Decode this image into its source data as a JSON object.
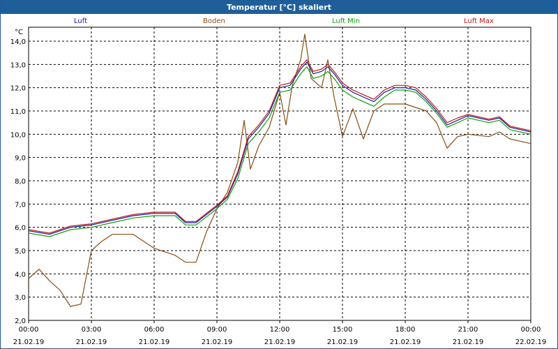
{
  "chart_data": {
    "type": "line",
    "title": "Temperatur [°C] skaliert",
    "ylabel": "°C",
    "ylim": [
      2.0,
      14.6
    ],
    "yticks": [
      "2,0",
      "3,0",
      "4,0",
      "5,0",
      "6,0",
      "7,0",
      "8,0",
      "9,0",
      "10,0",
      "11,0",
      "12,0",
      "13,0",
      "14,0"
    ],
    "ytick_values": [
      2,
      3,
      4,
      5,
      6,
      7,
      8,
      9,
      10,
      11,
      12,
      13,
      14
    ],
    "x_hours": [
      0,
      24
    ],
    "xtick_times": [
      "00:00",
      "03:00",
      "06:00",
      "09:00",
      "12:00",
      "15:00",
      "18:00",
      "21:00",
      "00:00"
    ],
    "xtick_dates": [
      "21.02.19",
      "21.02.19",
      "21.02.19",
      "21.02.19",
      "21.02.19",
      "21.02.19",
      "21.02.19",
      "21.02.19",
      "22.02.19"
    ],
    "grid": true,
    "legend_position": "top",
    "series": [
      {
        "name": "Luft",
        "color": "#1a1aa8",
        "points": [
          [
            0,
            5.85
          ],
          [
            1,
            5.7
          ],
          [
            2,
            6.0
          ],
          [
            3,
            6.1
          ],
          [
            4,
            6.3
          ],
          [
            5,
            6.5
          ],
          [
            6,
            6.6
          ],
          [
            7,
            6.6
          ],
          [
            7.5,
            6.2
          ],
          [
            8,
            6.2
          ],
          [
            9,
            6.9
          ],
          [
            9.5,
            7.3
          ],
          [
            10,
            8.3
          ],
          [
            10.5,
            9.8
          ],
          [
            11,
            10.3
          ],
          [
            11.5,
            10.9
          ],
          [
            12,
            12.0
          ],
          [
            12.5,
            12.1
          ],
          [
            13,
            12.8
          ],
          [
            13.3,
            13.1
          ],
          [
            13.6,
            12.6
          ],
          [
            14,
            12.7
          ],
          [
            14.3,
            12.9
          ],
          [
            14.6,
            12.6
          ],
          [
            15,
            12.1
          ],
          [
            15.5,
            11.8
          ],
          [
            16,
            11.6
          ],
          [
            16.5,
            11.4
          ],
          [
            17,
            11.8
          ],
          [
            17.5,
            12.0
          ],
          [
            18,
            12.0
          ],
          [
            18.5,
            11.9
          ],
          [
            19,
            11.5
          ],
          [
            19.5,
            11.0
          ],
          [
            20,
            10.4
          ],
          [
            20.5,
            10.6
          ],
          [
            21,
            10.8
          ],
          [
            21.5,
            10.7
          ],
          [
            22,
            10.6
          ],
          [
            22.5,
            10.7
          ],
          [
            23,
            10.3
          ],
          [
            23.5,
            10.2
          ],
          [
            24,
            10.1
          ]
        ]
      },
      {
        "name": "Boden",
        "color": "#8b4c12",
        "points": [
          [
            0,
            3.8
          ],
          [
            0.5,
            4.2
          ],
          [
            1,
            3.7
          ],
          [
            1.5,
            3.3
          ],
          [
            2,
            2.6
          ],
          [
            2.5,
            2.7
          ],
          [
            3,
            5.0
          ],
          [
            3.5,
            5.4
          ],
          [
            4,
            5.7
          ],
          [
            5,
            5.7
          ],
          [
            6,
            5.1
          ],
          [
            7,
            4.8
          ],
          [
            7.5,
            4.5
          ],
          [
            8,
            4.5
          ],
          [
            8.5,
            5.8
          ],
          [
            9,
            6.8
          ],
          [
            9.5,
            7.5
          ],
          [
            10,
            8.8
          ],
          [
            10.3,
            10.6
          ],
          [
            10.6,
            8.5
          ],
          [
            11,
            9.5
          ],
          [
            11.5,
            10.3
          ],
          [
            12,
            11.8
          ],
          [
            12.3,
            10.4
          ],
          [
            12.6,
            12.1
          ],
          [
            13,
            13.2
          ],
          [
            13.2,
            14.3
          ],
          [
            13.5,
            12.4
          ],
          [
            14,
            12.0
          ],
          [
            14.3,
            13.2
          ],
          [
            14.6,
            11.6
          ],
          [
            15,
            9.9
          ],
          [
            15.5,
            11.1
          ],
          [
            16,
            9.8
          ],
          [
            16.5,
            11.0
          ],
          [
            17,
            11.3
          ],
          [
            18,
            11.3
          ],
          [
            19,
            11.0
          ],
          [
            19.5,
            10.5
          ],
          [
            20,
            9.4
          ],
          [
            20.5,
            9.9
          ],
          [
            21,
            10.0
          ],
          [
            22,
            9.9
          ],
          [
            22.5,
            10.1
          ],
          [
            23,
            9.8
          ],
          [
            24,
            9.6
          ]
        ]
      },
      {
        "name": "Luft Min",
        "color": "#10a010",
        "points": [
          [
            0,
            5.75
          ],
          [
            1,
            5.6
          ],
          [
            2,
            5.9
          ],
          [
            3,
            6.0
          ],
          [
            4,
            6.2
          ],
          [
            5,
            6.4
          ],
          [
            6,
            6.5
          ],
          [
            7,
            6.5
          ],
          [
            7.5,
            6.1
          ],
          [
            8,
            6.1
          ],
          [
            9,
            6.8
          ],
          [
            9.5,
            7.2
          ],
          [
            10,
            8.1
          ],
          [
            10.5,
            9.6
          ],
          [
            11,
            10.1
          ],
          [
            11.5,
            10.7
          ],
          [
            12,
            11.8
          ],
          [
            12.5,
            11.9
          ],
          [
            13,
            12.6
          ],
          [
            13.3,
            12.9
          ],
          [
            13.6,
            12.4
          ],
          [
            14,
            12.5
          ],
          [
            14.3,
            12.7
          ],
          [
            14.6,
            12.4
          ],
          [
            15,
            11.9
          ],
          [
            15.5,
            11.6
          ],
          [
            16,
            11.4
          ],
          [
            16.5,
            11.2
          ],
          [
            17,
            11.6
          ],
          [
            17.5,
            11.9
          ],
          [
            18,
            11.9
          ],
          [
            18.5,
            11.8
          ],
          [
            19,
            11.4
          ],
          [
            19.5,
            10.9
          ],
          [
            20,
            10.3
          ],
          [
            20.5,
            10.5
          ],
          [
            21,
            10.7
          ],
          [
            21.5,
            10.6
          ],
          [
            22,
            10.5
          ],
          [
            22.5,
            10.6
          ],
          [
            23,
            10.2
          ],
          [
            23.5,
            10.1
          ],
          [
            24,
            10.0
          ]
        ]
      },
      {
        "name": "Luft Max",
        "color": "#c21818",
        "points": [
          [
            0,
            5.9
          ],
          [
            1,
            5.75
          ],
          [
            2,
            6.05
          ],
          [
            3,
            6.15
          ],
          [
            4,
            6.35
          ],
          [
            5,
            6.55
          ],
          [
            6,
            6.65
          ],
          [
            7,
            6.65
          ],
          [
            7.5,
            6.25
          ],
          [
            8,
            6.25
          ],
          [
            9,
            6.95
          ],
          [
            9.5,
            7.35
          ],
          [
            10,
            8.4
          ],
          [
            10.5,
            9.9
          ],
          [
            11,
            10.4
          ],
          [
            11.5,
            11.0
          ],
          [
            12,
            12.1
          ],
          [
            12.5,
            12.2
          ],
          [
            13,
            12.9
          ],
          [
            13.3,
            13.2
          ],
          [
            13.6,
            12.7
          ],
          [
            14,
            12.8
          ],
          [
            14.3,
            13.0
          ],
          [
            14.6,
            12.7
          ],
          [
            15,
            12.2
          ],
          [
            15.5,
            11.9
          ],
          [
            16,
            11.7
          ],
          [
            16.5,
            11.5
          ],
          [
            17,
            11.9
          ],
          [
            17.5,
            12.1
          ],
          [
            18,
            12.1
          ],
          [
            18.5,
            12.0
          ],
          [
            19,
            11.6
          ],
          [
            19.5,
            11.1
          ],
          [
            20,
            10.5
          ],
          [
            20.5,
            10.7
          ],
          [
            21,
            10.85
          ],
          [
            21.5,
            10.75
          ],
          [
            22,
            10.65
          ],
          [
            22.5,
            10.75
          ],
          [
            23,
            10.35
          ],
          [
            23.5,
            10.25
          ],
          [
            24,
            10.15
          ]
        ]
      }
    ]
  }
}
